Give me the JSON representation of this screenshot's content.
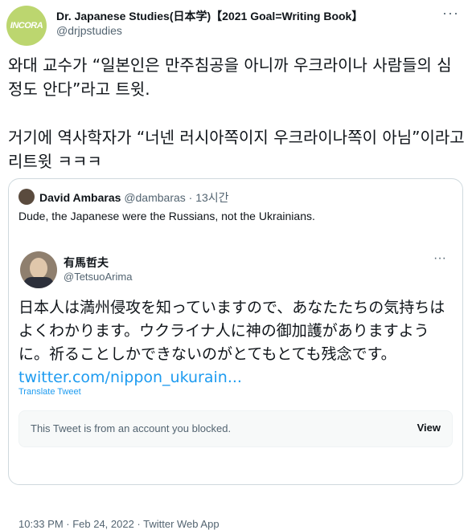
{
  "tweet": {
    "avatar_text": "INCORA",
    "author_name": "Dr. Japanese Studies(日本学)【2021 Goal=Writing Book】",
    "author_handle": "@drjpstudies",
    "more": "···",
    "text": "와대 교수가 “일본인은 만주침공을 아니까 우크라이나 사람들의 심정도 안다”라고 트윗.\n\n거기에 역사학자가 “너넨 러시아쪽이지 우크라이나쪽이 아님”이라고 리트윗 ㅋㅋㅋ"
  },
  "quote": {
    "name": "David Ambaras",
    "handle_time": "@dambaras · 13시간",
    "text": "Dude, the Japanese were the Russians, not the Ukrainians.",
    "inner": {
      "name": "有馬哲夫",
      "handle": "@TetsuoArima",
      "more": "···",
      "text": "日本人は満州侵攻を知っていますので、あなたたちの気持ちはよくわかります。ウクライナ人に神の御加護がありますように。祈ることしかできないのがとてもとても残念です。",
      "link": "twitter.com/nippon_ukurain...",
      "translate": "Translate Tweet",
      "blocked_text": "This Tweet is from an account you blocked.",
      "view_label": "View",
      "footer": "10:33 PM · Feb 24, 2022 · Twitter Web App"
    }
  }
}
